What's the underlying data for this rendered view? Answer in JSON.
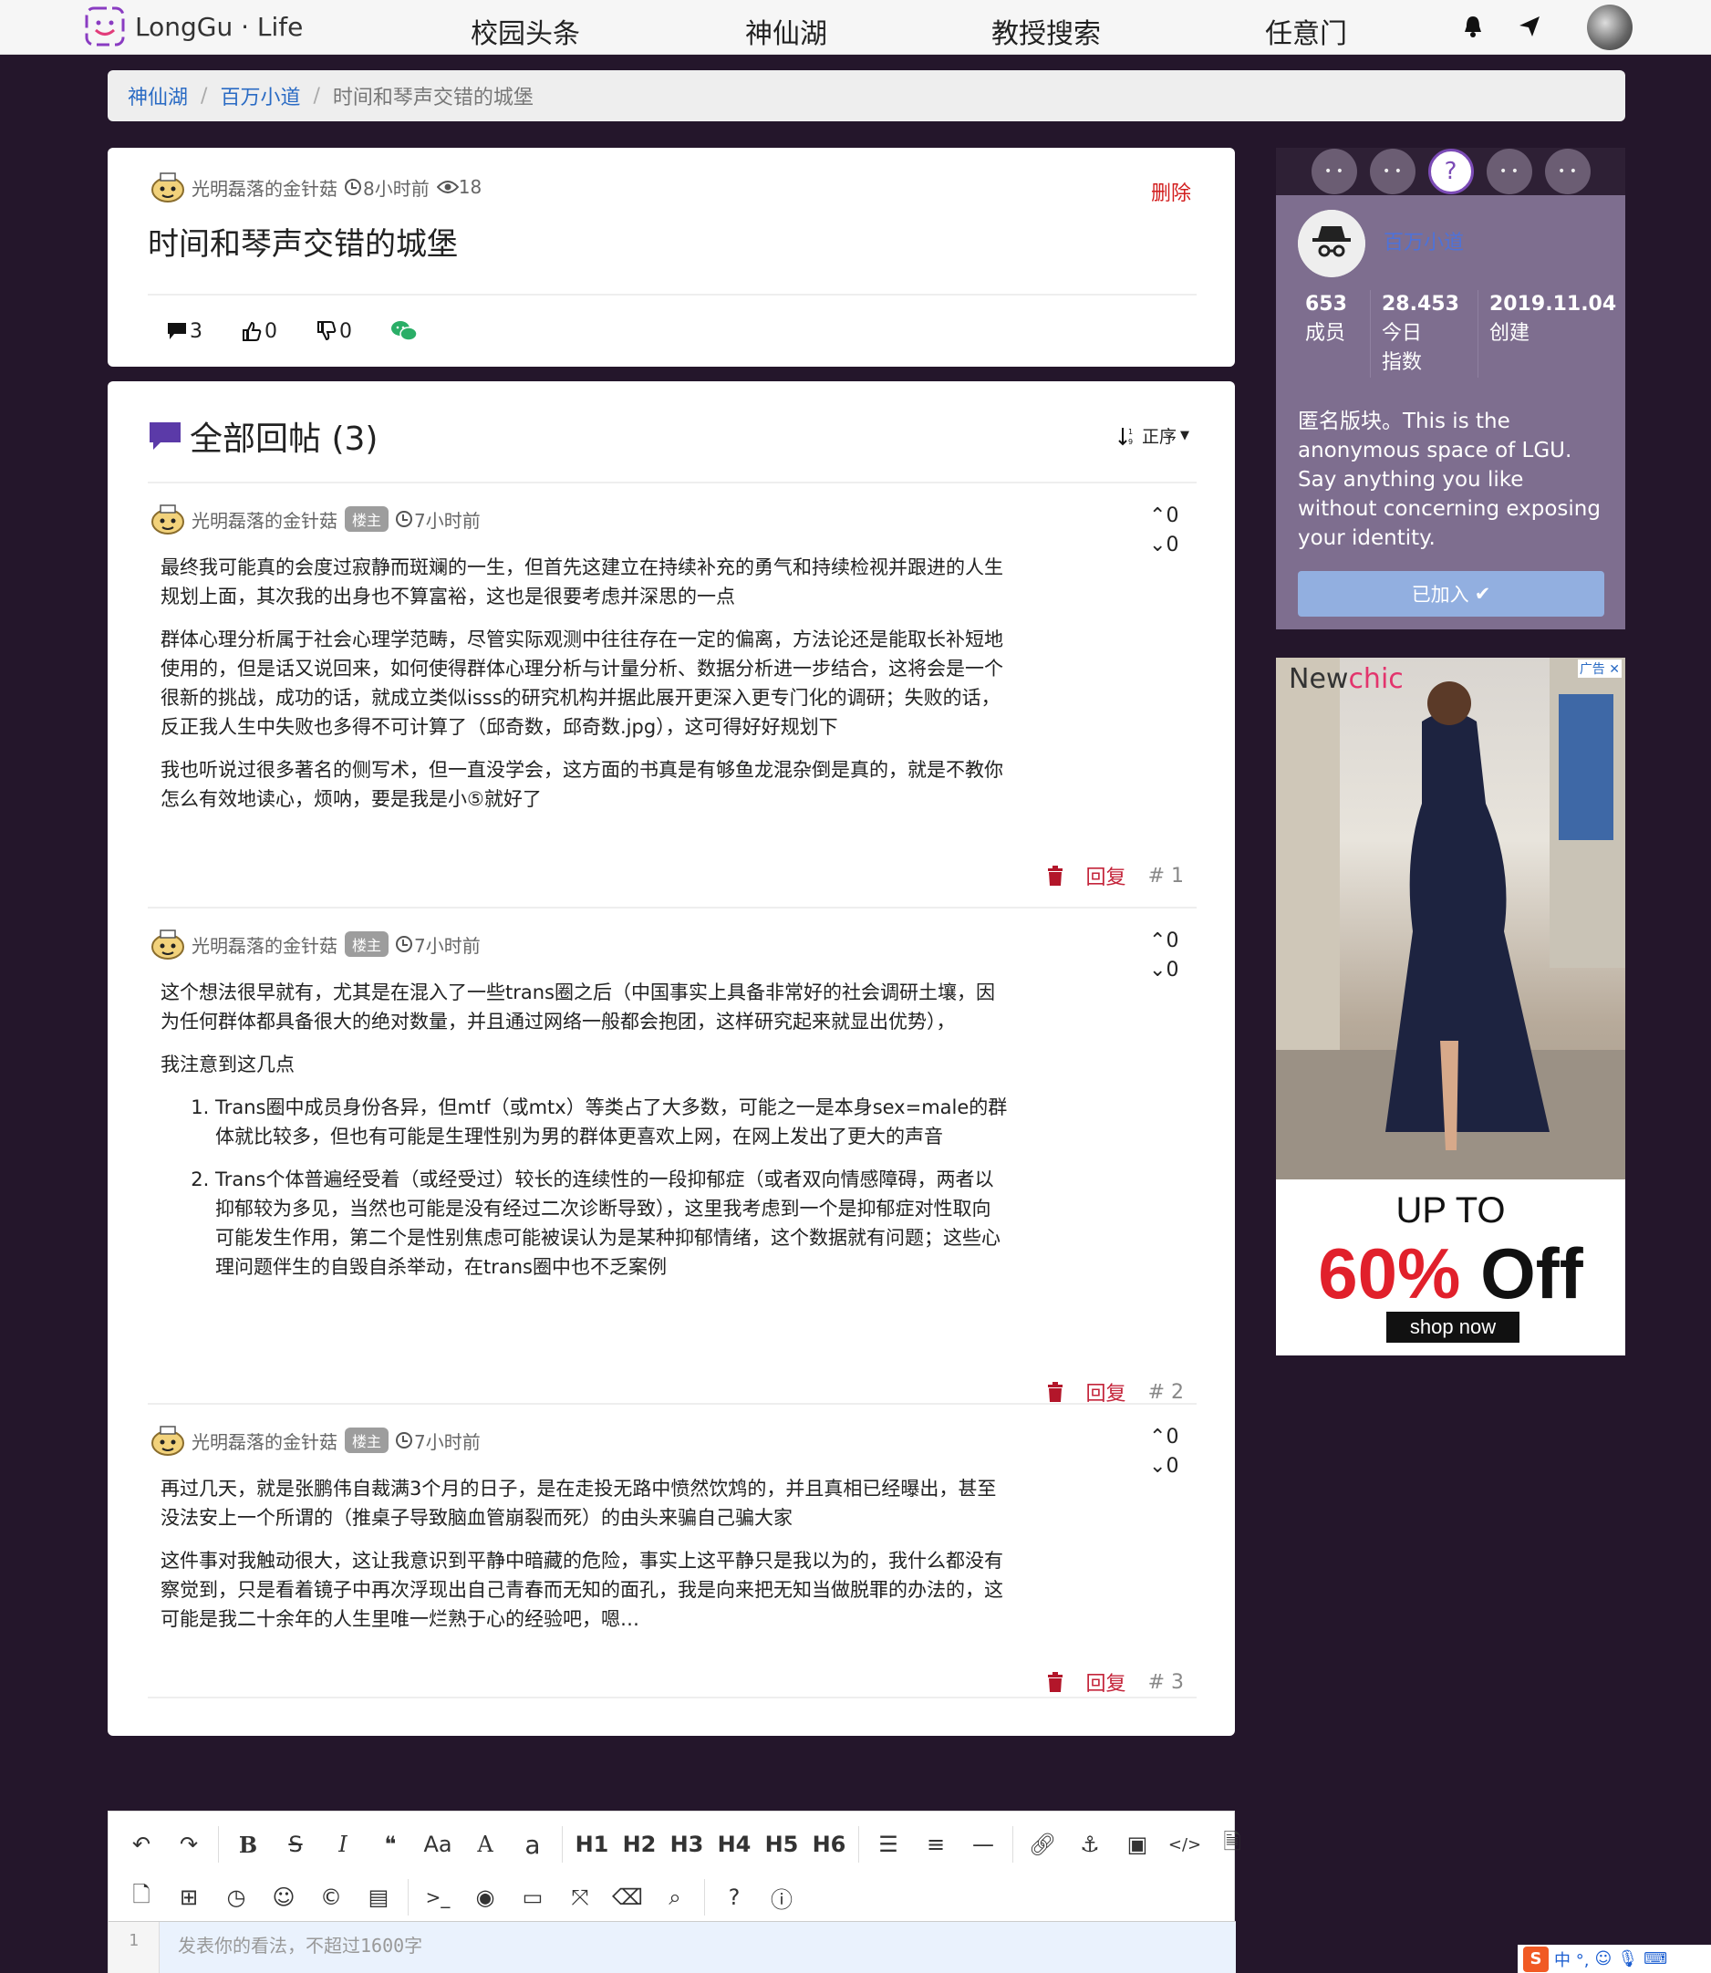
{
  "nav": {
    "logo_text": "LongGu · Life",
    "links": [
      "校园头条",
      "神仙湖",
      "教授搜索",
      "任意门"
    ]
  },
  "breadcrumb": {
    "items": [
      "神仙湖",
      "百万小道"
    ],
    "current": "时间和琴声交错的城堡"
  },
  "post": {
    "author": "光明磊落的金针菇",
    "time": "8小时前",
    "views": "18",
    "delete_label": "删除",
    "title": "时间和琴声交错的城堡",
    "comments": "3",
    "likes": "0",
    "dislikes": "0"
  },
  "replies": {
    "heading": "全部回帖 (3)",
    "sort_label": "正序",
    "reply_label": "回复",
    "badge": "楼主",
    "items": [
      {
        "author": "光明磊落的金针菇",
        "time": "7小时前",
        "up": "0",
        "down": "0",
        "floor": "# 1",
        "paragraphs": [
          "最终我可能真的会度过寂静而斑斓的一生，但首先这建立在持续补充的勇气和持续检视并跟进的人生规划上面，其次我的出身也不算富裕，这也是很要考虑并深思的一点",
          "群体心理分析属于社会心理学范畴，尽管实际观测中往往存在一定的偏离，方法论还是能取长补短地使用的，但是话又说回来，如何使得群体心理分析与计量分析、数据分析进一步结合，这将会是一个很新的挑战，成功的话，就成立类似isss的研究机构并据此展开更深入更专门化的调研；失败的话，反正我人生中失败也多得不可计算了（邱奇数，邱奇数.jpg），这可得好好规划下",
          "我也听说过很多著名的侧写术，但一直没学会，这方面的书真是有够鱼龙混杂倒是真的，就是不教你怎么有效地读心，烦呐，要是我是小⑤就好了"
        ]
      },
      {
        "author": "光明磊落的金针菇",
        "time": "7小时前",
        "up": "0",
        "down": "0",
        "floor": "# 2",
        "paragraphs": [
          "这个想法很早就有，尤其是在混入了一些trans圈之后（中国事实上具备非常好的社会调研土壤，因为任何群体都具备很大的绝对数量，并且通过网络一般都会抱团，这样研究起来就显出优势），",
          "我注意到这几点"
        ],
        "list": [
          "Trans圈中成员身份各异，但mtf（或mtx）等类占了大多数，可能之一是本身sex=male的群体就比较多，但也有可能是生理性别为男的群体更喜欢上网，在网上发出了更大的声音",
          "Trans个体普遍经受着（或经受过）较长的连续性的一段抑郁症（或者双向情感障碍，两者以抑郁较为多见，当然也可能是没有经过二次诊断导致），这里我考虑到一个是抑郁症对性取向可能发生作用，第二个是性别焦虑可能被误认为是某种抑郁情绪，这个数据就有问题；这些心理问题伴生的自毁自杀举动，在trans圈中也不乏案例"
        ]
      },
      {
        "author": "光明磊落的金针菇",
        "time": "7小时前",
        "up": "0",
        "down": "0",
        "floor": "# 3",
        "paragraphs": [
          "再过几天，就是张鹏伟自裁满3个月的日子，是在走投无路中愤然饮鸩的，并且真相已经曝出，甚至没法安上一个所谓的（推桌子导致脑血管崩裂而死）的由头来骗自己骗大家",
          "这件事对我触动很大，这让我意识到平静中暗藏的危险，事实上这平静只是我以为的，我什么都没有察觉到，只是看着镜子中再次浮现出自己青春而无知的面孔，我是向来把无知当做脱罪的办法的，这可能是我二十余年的人生里唯一烂熟于心的经验吧，嗯…"
        ]
      }
    ]
  },
  "sidebar": {
    "board_name": "百万小道",
    "stats": [
      {
        "value": "653",
        "label": "成员"
      },
      {
        "value": "28.453",
        "label": "今日指数"
      },
      {
        "value": "2019.11.04",
        "label": "创建"
      }
    ],
    "description": "匿名版块。This is the anonymous space of LGU. Say anything you like without concerning exposing your identity.",
    "joined_label": "已加入"
  },
  "ad": {
    "brand_a": "New",
    "brand_b": "chic",
    "tag": "广告",
    "upto": "UP TO",
    "off_pct": "60%",
    "off_word": " Off",
    "shop": "shop now"
  },
  "editor": {
    "headings": [
      "H1",
      "H2",
      "H3",
      "H4",
      "H5",
      "H6"
    ],
    "line_no": "1",
    "placeholder": "发表你的看法，不超过1600字"
  },
  "ime": {
    "label": "中 °,"
  },
  "colors": {
    "page_bg": "#24162b",
    "accent_red": "#d21d1d",
    "side_card": "#7e6e8f",
    "link_blue": "#2a6bc4"
  }
}
